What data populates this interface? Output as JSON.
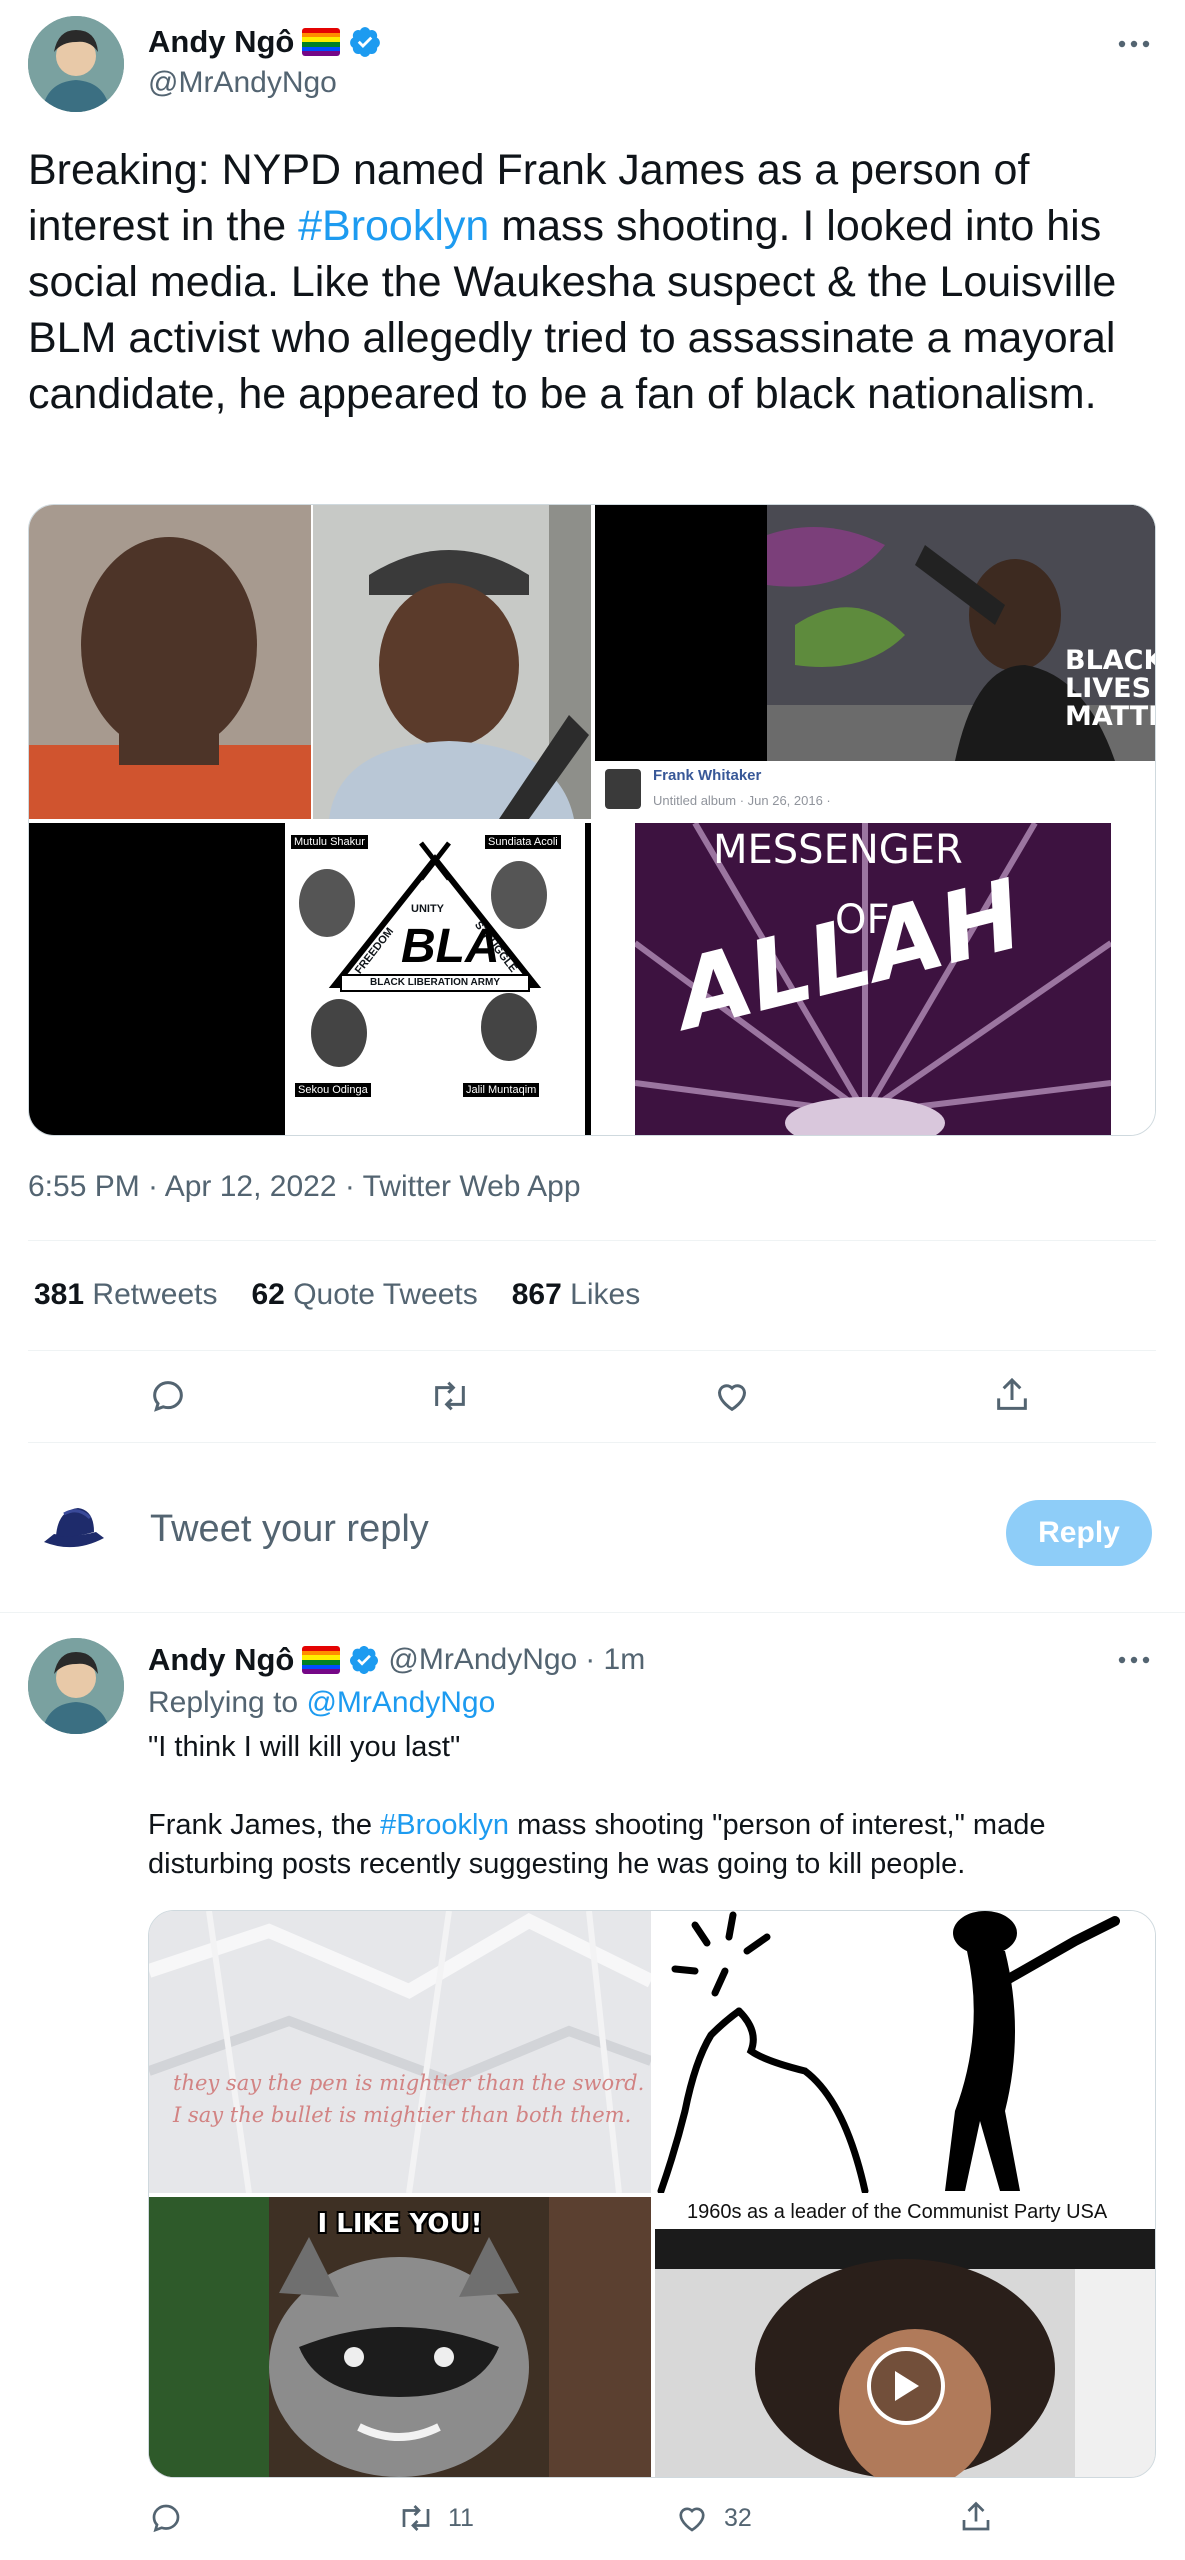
{
  "tweet": {
    "author_name": "Andy Ngô",
    "author_handle": "@MrAndyNgo",
    "text_before": "Breaking: NYPD named Frank James as a person of interest in the ",
    "hashtag": "#Brooklyn",
    "text_after": " mass shooting. I looked into his social media. Like the Waukesha suspect & the Louisville BLM activist who allegedly tried to assassinate a mayoral candidate, he appeared to be a fan of black nationalism.",
    "timestamp": "6:55 PM · Apr 12, 2022 · Twitter Web App",
    "stats": {
      "retweets_count": "381",
      "retweets_label": "Retweets",
      "quotes_count": "62",
      "quotes_label": "Quote Tweets",
      "likes_count": "867",
      "likes_label": "Likes"
    },
    "media": {
      "fb_name": "Frank Whitaker",
      "fb_meta": "Untitled album · Jun 26, 2016 ·",
      "blm_text": [
        "BLACK",
        "LIVES",
        "MATTER"
      ],
      "bla_names": [
        "Mutulu Shakur",
        "Sundiata Acoli",
        "Sekou Odinga",
        "Jalil Muntaqim"
      ],
      "bla_words": [
        "UNITY",
        "FREEDOM",
        "STRUGGLE",
        "BLA",
        "BLACK LIBERATION ARMY"
      ],
      "messenger_lines": [
        "MESSENGER",
        "OF",
        "ALLAH"
      ]
    }
  },
  "reply_box": {
    "placeholder": "Tweet your reply",
    "button_label": "Reply"
  },
  "reply": {
    "author_name": "Andy Ngô",
    "author_handle": "@MrAndyNgo",
    "time": "· 1m",
    "replying_prefix": "Replying to ",
    "replying_handle": "@MrAndyNgo",
    "line1": "\"I think I will kill you last\"",
    "line2_before": "Frank James, the ",
    "hashtag": "#Brooklyn",
    "line2_after": " mass shooting \"person of interest,\" made disturbing posts recently suggesting he was going to kill people.",
    "media": {
      "quote_line1": "they say the pen is mightier than the sword.",
      "quote_line2": "I say the bullet is mightier than both them.",
      "raccoon_text": "I LIKE YOU!",
      "video_caption": "1960s as a leader of the Communist Party USA"
    },
    "actions": {
      "retweets": "11",
      "likes": "32"
    }
  },
  "colors": {
    "accent": "#1d9bf0",
    "reply_button_disabled": "#8ecdf8",
    "text": "#0f1419",
    "muted": "#536471",
    "divider": "#eff3f4"
  }
}
